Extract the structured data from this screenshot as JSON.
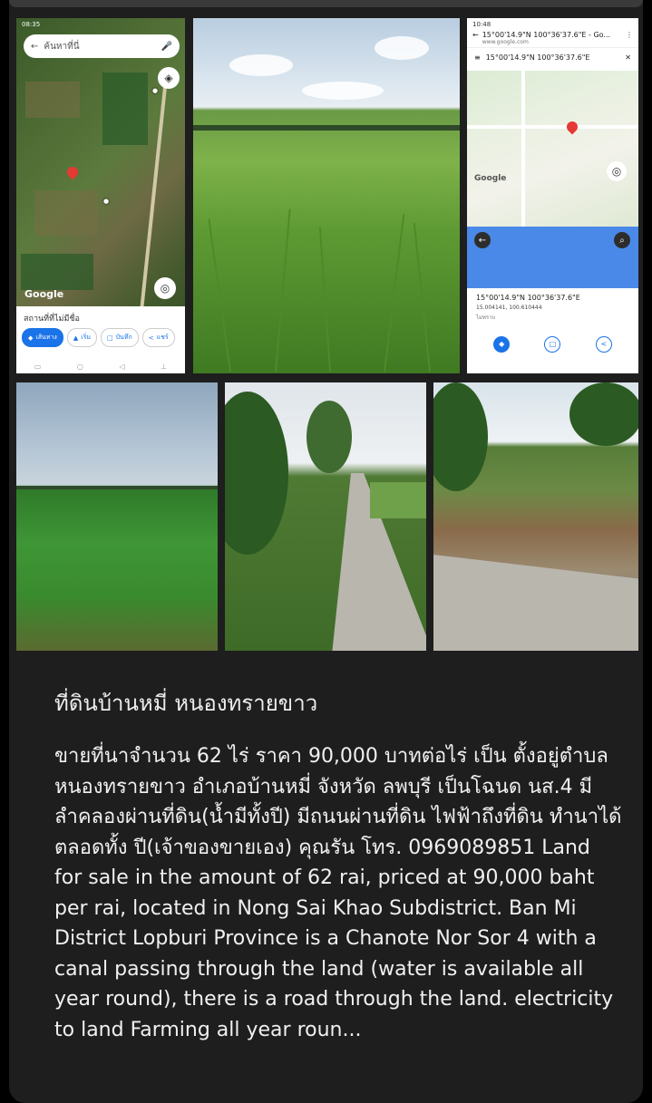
{
  "map1": {
    "search_placeholder": "ค้นหาที่นี่",
    "google": "Google",
    "sheet_title": "สถานที่ที่ไม่มีชื่อ",
    "chips": [
      "เส้นทาง",
      "เริ่ม",
      "บันทึก",
      "แชร์"
    ],
    "status": "08:35"
  },
  "map3": {
    "status": "10:48",
    "url_title": "15°00'14.9\"N 100°36'37.6\"E - Go...",
    "url_sub": "www.google.com",
    "query": "15°00'14.9\"N 100°36'37.6\"E",
    "google": "Google",
    "coords": "15°00'14.9\"N 100°36'37.6\"E",
    "decimal": "15.004141, 100.610444",
    "place_hint": "ไม่ทราบ"
  },
  "post": {
    "title": "ที่ดินบ้านหมี่ หนองทรายขาว",
    "body": "ขายที่นาจำนวน 62 ไร่ ราคา 90,000 บาทต่อไร่ เป็น ตั้งอยู่ตำบลหนองทรายขาว อำเภอบ้านหมี่ จังหวัด ลพบุรี เป็นโฉนด นส.4 มีลำคลองผ่านที่ดิน(น้ำมีทั้งปี) มีถนนผ่านที่ดิน ไฟฟ้าถึงที่ดิน ทำนาได้ตลอดทั้ง ปี(เจ้าของขายเอง) คุณรัน โทร. 0969089851 Land for sale in the amount of 62 rai, priced at 90,000 baht per rai, located in Nong Sai Khao Subdistrict. Ban Mi District Lopburi Province is a Chanote Nor Sor 4 with a canal passing through the land (water is available all year round), there is a road through the land. electricity to land Farming all year roun..."
  },
  "colors": {
    "background": "#000000",
    "card": "#1e1e1e",
    "text": "#f0f0f0",
    "map_accent": "#1a73e8",
    "pin": "#e53935"
  }
}
